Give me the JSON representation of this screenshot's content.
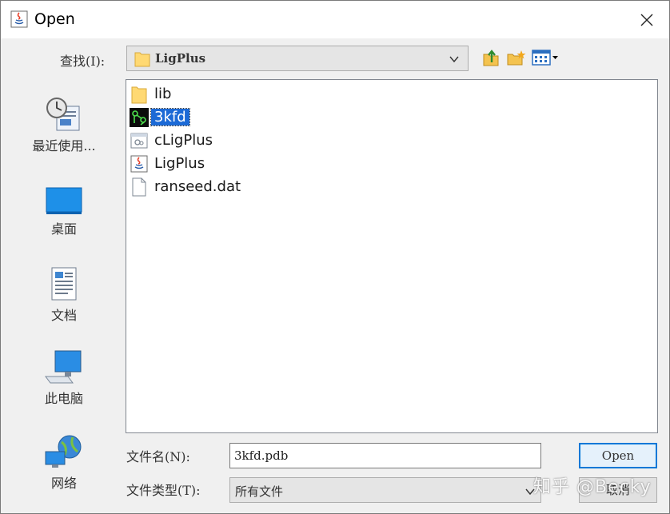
{
  "window": {
    "title": "Open",
    "close_glyph": "×"
  },
  "look_in": {
    "label": "查找(I):",
    "value": "LigPlus"
  },
  "toolbar": {
    "up_icon": "up-folder-icon",
    "new_folder_icon": "new-folder-icon",
    "view_icon": "details-view-icon"
  },
  "places": [
    {
      "label": "最近使用...",
      "icon": "recent-icon"
    },
    {
      "label": "桌面",
      "icon": "desktop-icon"
    },
    {
      "label": "文档",
      "icon": "documents-icon"
    },
    {
      "label": "此电脑",
      "icon": "computer-icon"
    },
    {
      "label": "网络",
      "icon": "network-icon"
    }
  ],
  "files": [
    {
      "name": "lib",
      "icon": "folder-icon",
      "selected": false
    },
    {
      "name": "3kfd",
      "icon": "molecule-icon",
      "selected": true
    },
    {
      "name": "cLigPlus",
      "icon": "app-icon",
      "selected": false
    },
    {
      "name": "LigPlus",
      "icon": "java-icon",
      "selected": false
    },
    {
      "name": "ranseed.dat",
      "icon": "file-icon",
      "selected": false
    }
  ],
  "file_name": {
    "label": "文件名(N):",
    "value": "3kfd.pdb"
  },
  "file_type": {
    "label": "文件类型(T):",
    "value": "所有文件"
  },
  "buttons": {
    "open": "Open",
    "cancel": "取消"
  },
  "watermark": "知乎 @Becky",
  "colors": {
    "selection": "#1c6ad6",
    "focus_border": "#0078d7"
  }
}
